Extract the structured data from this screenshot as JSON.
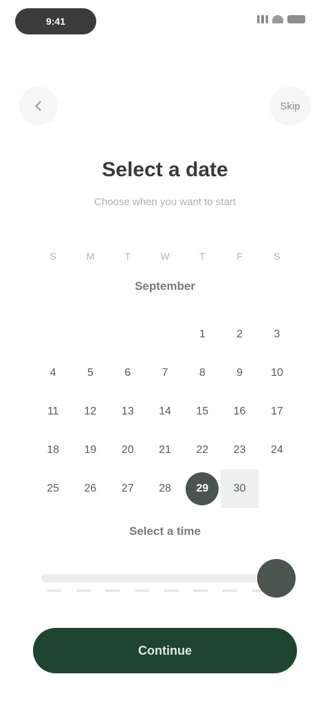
{
  "status_bar": {
    "time": "9:41"
  },
  "nav": {
    "right_label": "Skip"
  },
  "header": {
    "title": "Select a date",
    "subtitle": "Choose when you want to start"
  },
  "calendar": {
    "weekdays": [
      "S",
      "M",
      "T",
      "W",
      "T",
      "F",
      "S"
    ],
    "month": "September",
    "cells": [
      "",
      "",
      "",
      "",
      "1",
      "2",
      "3",
      "4",
      "5",
      "6",
      "7",
      "8",
      "9",
      "10",
      "11",
      "12",
      "13",
      "14",
      "15",
      "16",
      "17",
      "18",
      "19",
      "20",
      "21",
      "22",
      "23",
      "24",
      "25",
      "26",
      "27",
      "28",
      "29",
      "30",
      ""
    ],
    "selected_day": "29",
    "range_days": [
      "30"
    ]
  },
  "time": {
    "label": "Select a time",
    "slider_value": 1.0
  },
  "primary_action": {
    "label": "Continue"
  }
}
